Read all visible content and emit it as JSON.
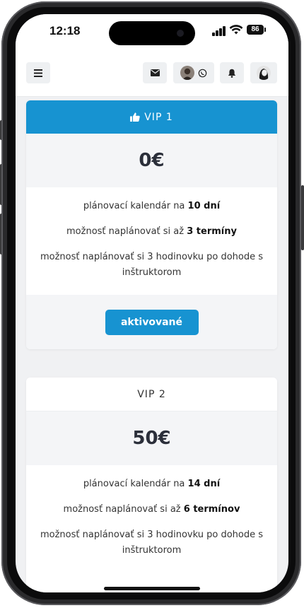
{
  "status_bar": {
    "time": "12:18",
    "battery": "86"
  },
  "header": {
    "menu_icon": "hamburger-icon",
    "mail_icon": "envelope-icon",
    "whatsapp_icon": "whatsapp-icon",
    "bell_icon": "bell-icon"
  },
  "plans": [
    {
      "name": "VIP 1",
      "name_icon": "thumbs-up-icon",
      "price": "0€",
      "features": [
        {
          "pre": "plánovací kalendár na ",
          "bold": "10 dní",
          "post": ""
        },
        {
          "pre": "možnosť naplánovať si až ",
          "bold": "3 termíny",
          "post": ""
        },
        {
          "pre": "možnosť naplánovať si 3 hodinovku po dohode s inštruktorom",
          "bold": "",
          "post": ""
        }
      ],
      "button_label": "aktivované",
      "active": true
    },
    {
      "name": "VIP 2",
      "price": "50€",
      "features": [
        {
          "pre": "plánovací kalendár na ",
          "bold": "14 dní",
          "post": ""
        },
        {
          "pre": "možnosť naplánovať si až ",
          "bold": "6 termínov",
          "post": ""
        },
        {
          "pre": "možnosť naplánovať si 3 hodinovku po dohode s inštruktorom",
          "bold": "",
          "post": ""
        }
      ],
      "active": false
    }
  ],
  "colors": {
    "accent": "#1793d1",
    "page_bg": "#f0f1f3",
    "text": "#333333"
  }
}
